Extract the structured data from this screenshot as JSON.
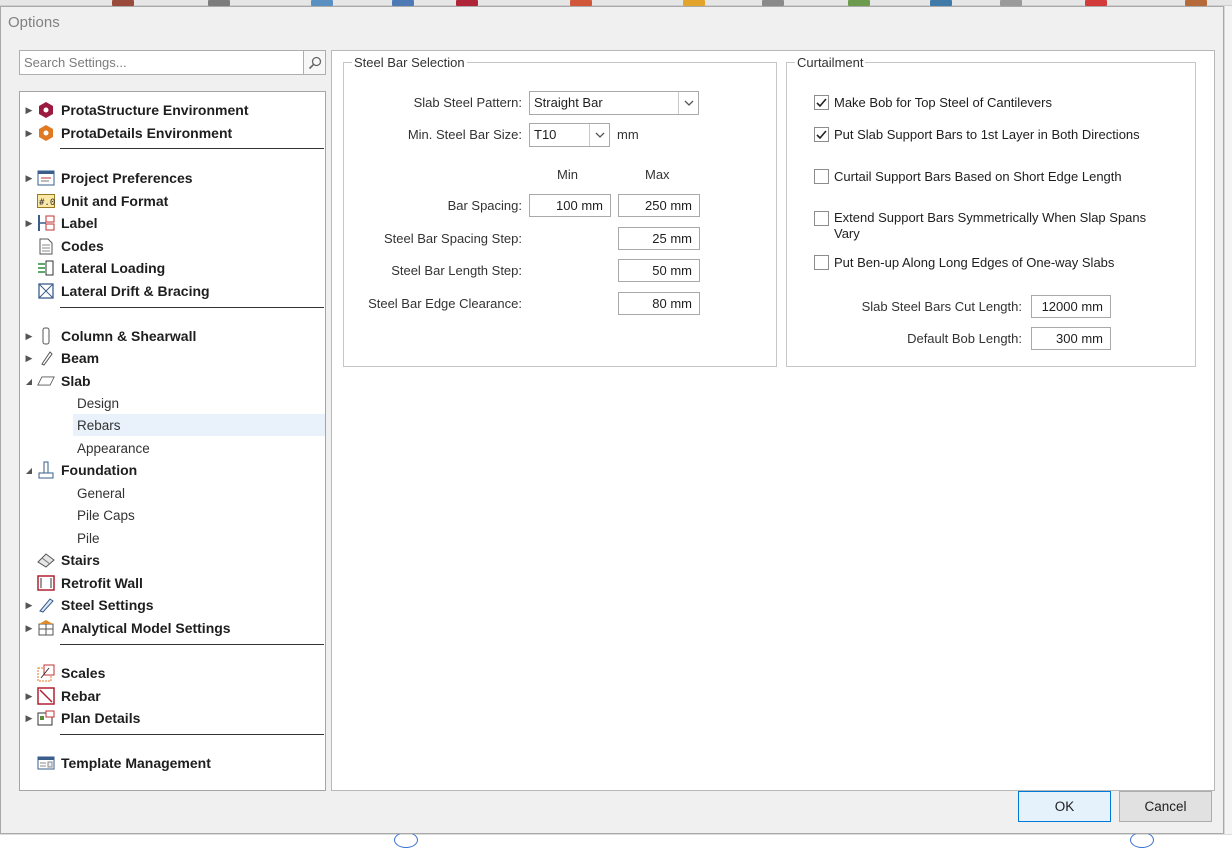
{
  "window": {
    "title": "Options"
  },
  "search": {
    "placeholder": "Search Settings..."
  },
  "tree": {
    "groups": [
      {
        "label": "ProtaStructure Environment"
      },
      {
        "label": "ProtaDetails Environment"
      },
      {
        "label": "Project Preferences"
      },
      {
        "label": "Unit and Format"
      },
      {
        "label": "Label"
      },
      {
        "label": "Codes"
      },
      {
        "label": "Lateral Loading"
      },
      {
        "label": "Lateral Drift & Bracing"
      },
      {
        "label": "Column & Shearwall"
      },
      {
        "label": "Beam"
      },
      {
        "label": "Slab"
      },
      {
        "label": "Design"
      },
      {
        "label": "Rebars"
      },
      {
        "label": "Appearance"
      },
      {
        "label": "Foundation"
      },
      {
        "label": "General"
      },
      {
        "label": "Pile Caps"
      },
      {
        "label": "Pile"
      },
      {
        "label": "Stairs"
      },
      {
        "label": "Retrofit Wall"
      },
      {
        "label": "Steel Settings"
      },
      {
        "label": "Analytical Model Settings"
      },
      {
        "label": "Scales"
      },
      {
        "label": "Rebar"
      },
      {
        "label": "Plan Details"
      },
      {
        "label": "Template Management"
      }
    ]
  },
  "steel_bar_selection": {
    "legend": "Steel Bar Selection",
    "pattern_label": "Slab Steel Pattern:",
    "pattern_value": "Straight Bar",
    "min_size_label": "Min. Steel Bar Size:",
    "min_size_value": "T10",
    "min_size_unit": "mm",
    "col_min": "Min",
    "col_max": "Max",
    "bar_spacing_label": "Bar Spacing:",
    "bar_spacing_min": "100 mm",
    "bar_spacing_max": "250 mm",
    "spacing_step_label": "Steel Bar Spacing Step:",
    "spacing_step_value": "25 mm",
    "length_step_label": "Steel Bar Length Step:",
    "length_step_value": "50 mm",
    "edge_clearance_label": "Steel Bar Edge Clearance:",
    "edge_clearance_value": "80 mm"
  },
  "curtailment": {
    "legend": "Curtailment",
    "options": [
      {
        "label": "Make Bob for Top Steel of Cantilevers",
        "checked": true
      },
      {
        "label": "Put Slab Support Bars to 1st Layer in Both Directions",
        "checked": true
      },
      {
        "label": "Curtail Support Bars Based on Short Edge Length",
        "checked": false
      },
      {
        "label": "Extend Support Bars Symmetrically When Slap Spans Vary",
        "checked": false
      },
      {
        "label": "Put Ben-up Along Long Edges of One-way Slabs",
        "checked": false
      }
    ],
    "cut_length_label": "Slab Steel Bars Cut Length:",
    "cut_length_value": "12000 mm",
    "bob_length_label": "Default Bob Length:",
    "bob_length_value": "300 mm"
  },
  "buttons": {
    "ok": "OK",
    "cancel": "Cancel"
  },
  "colors": {
    "accent": "#0078d7",
    "selection": "#e9f2fb"
  }
}
